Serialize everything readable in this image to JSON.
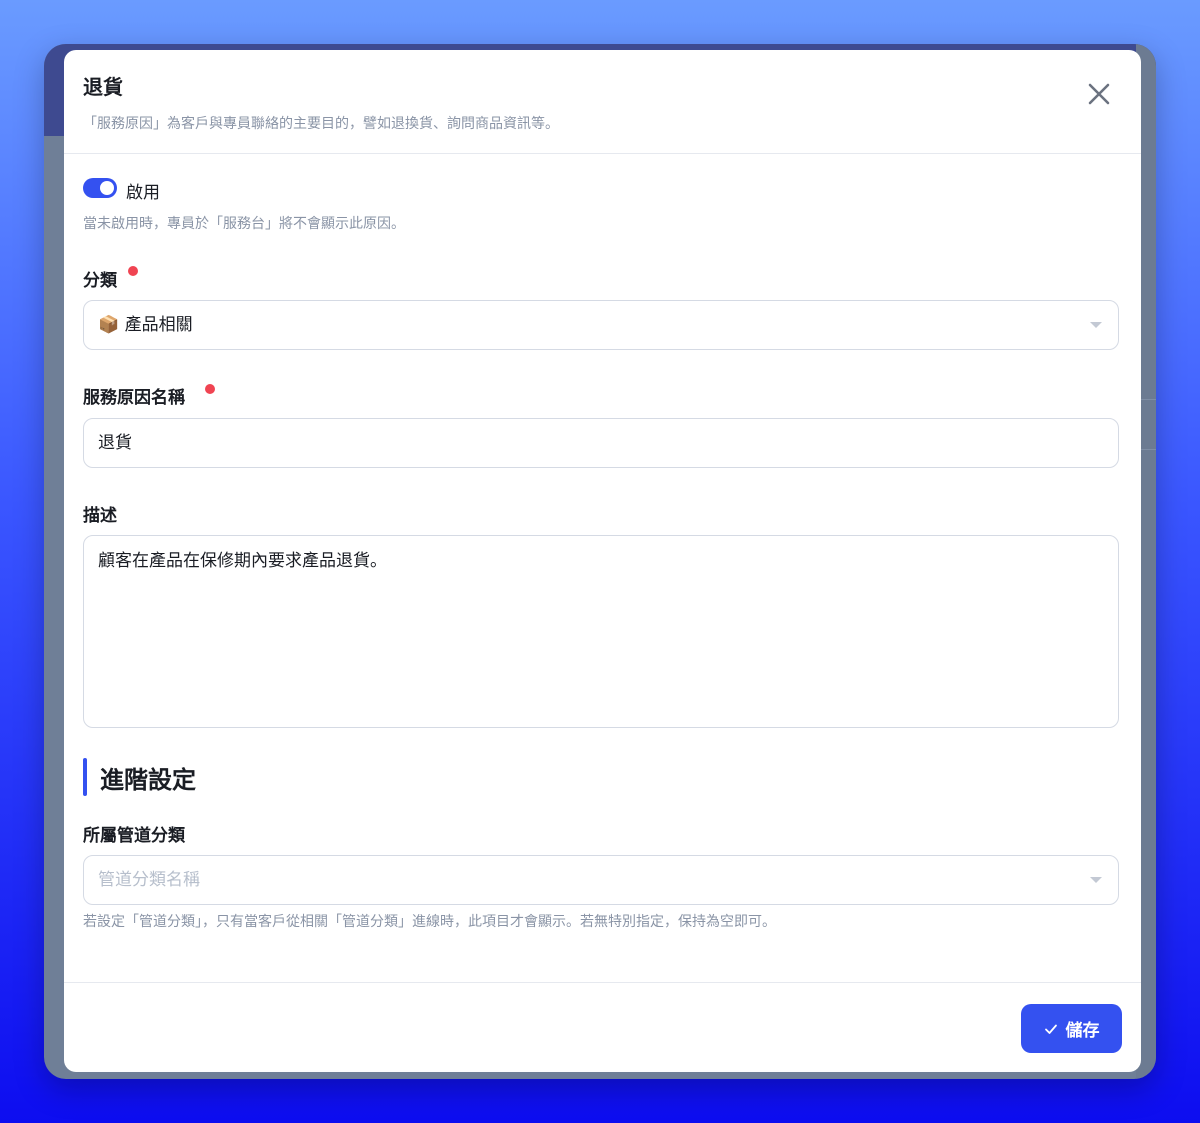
{
  "modal": {
    "title": "退貨",
    "subtitle": "「服務原因」為客戶與專員聯絡的主要目的，譬如退換貨、詢問商品資訊等。"
  },
  "enable": {
    "label": "啟用",
    "checked": true,
    "help": "當未啟用時，專員於「服務台」將不會顯示此原因。"
  },
  "category": {
    "label": "分類",
    "required": true,
    "value_emoji": "📦",
    "value": "產品相關"
  },
  "reason_name": {
    "label": "服務原因名稱",
    "required": true,
    "value": "退貨"
  },
  "description": {
    "label": "描述",
    "value": "顧客在產品在保修期內要求產品退貨。"
  },
  "advanced": {
    "section_title": "進階設定",
    "channel_category": {
      "label": "所屬管道分類",
      "placeholder": "管道分類名稱",
      "help": "若設定「管道分類」，只有當客戶從相關「管道分類」進線時，此項目才會顯示。若無特別指定，保持為空即可。"
    }
  },
  "footer": {
    "save_label": "儲存"
  },
  "colors": {
    "accent": "#3451f0",
    "required_dot": "#f04452"
  }
}
